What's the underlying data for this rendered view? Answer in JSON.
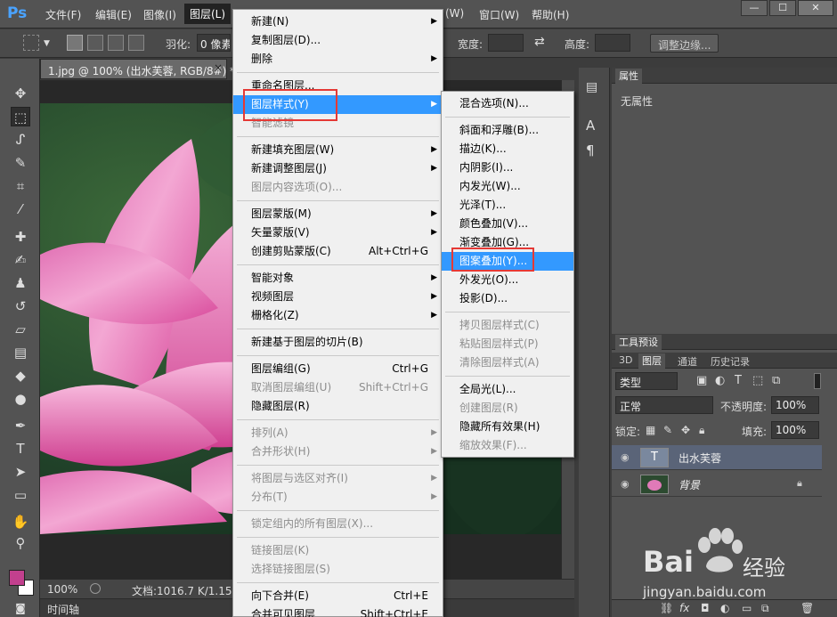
{
  "app": {
    "logo": "Ps"
  },
  "menubar": {
    "items": [
      "文件(F)",
      "编辑(E)",
      "图像(I)",
      "图层(L)",
      "窗口(W)",
      "帮助(H)"
    ],
    "partial_item": "(W)",
    "window_buttons": [
      "—",
      "☐",
      "✕"
    ]
  },
  "options": {
    "feather_label": "羽化:",
    "feather_value": "0 像素",
    "width_label": "宽度:",
    "height_label": "高度:",
    "refine_edge": "调整边缘..."
  },
  "document": {
    "tab_title": "1.jpg @ 100% (出水芙蓉, RGB/8#) *",
    "close": "×",
    "zoom": "100%",
    "doc_info": "文档:1016.7 K/1.15M",
    "timeline": "时间轴"
  },
  "properties_panel": {
    "tab": "属性",
    "content": "无属性"
  },
  "tool_presets": {
    "tab": "工具预设"
  },
  "layers_panel": {
    "tabs": [
      "3D",
      "图层",
      "通道",
      "历史记录"
    ],
    "active_tab": "图层",
    "filter_kind": "类型",
    "blend_mode": "正常",
    "opacity_label": "不透明度:",
    "opacity_value": "100%",
    "lock_label": "锁定:",
    "fill_label": "填充:",
    "fill_value": "100%",
    "layers": [
      {
        "name": "出水芙蓉",
        "type": "text",
        "thumb": "T",
        "selected": true
      },
      {
        "name": "背景",
        "type": "image",
        "locked": true,
        "selected": false
      }
    ]
  },
  "layer_menu": {
    "items": [
      {
        "label": "新建(N)",
        "submenu": true
      },
      {
        "label": "复制图层(D)..."
      },
      {
        "label": "删除",
        "submenu": true
      },
      {
        "sep": true
      },
      {
        "label": "重命名图层..."
      },
      {
        "label": "图层样式(Y)",
        "submenu": true,
        "highlighted": true
      },
      {
        "label": "智能滤镜",
        "disabled": true
      },
      {
        "sep": true
      },
      {
        "label": "新建填充图层(W)",
        "submenu": true
      },
      {
        "label": "新建调整图层(J)",
        "submenu": true
      },
      {
        "label": "图层内容选项(O)...",
        "disabled": true
      },
      {
        "sep": true
      },
      {
        "label": "图层蒙版(M)",
        "submenu": true
      },
      {
        "label": "矢量蒙版(V)",
        "submenu": true
      },
      {
        "label": "创建剪贴蒙版(C)",
        "shortcut": "Alt+Ctrl+G"
      },
      {
        "sep": true
      },
      {
        "label": "智能对象",
        "submenu": true
      },
      {
        "label": "视频图层",
        "submenu": true
      },
      {
        "label": "栅格化(Z)",
        "submenu": true
      },
      {
        "sep": true
      },
      {
        "label": "新建基于图层的切片(B)"
      },
      {
        "sep": true
      },
      {
        "label": "图层编组(G)",
        "shortcut": "Ctrl+G"
      },
      {
        "label": "取消图层编组(U)",
        "shortcut": "Shift+Ctrl+G",
        "disabled": true
      },
      {
        "label": "隐藏图层(R)"
      },
      {
        "sep": true
      },
      {
        "label": "排列(A)",
        "submenu": true,
        "disabled": true
      },
      {
        "label": "合并形状(H)",
        "submenu": true,
        "disabled": true
      },
      {
        "sep": true
      },
      {
        "label": "将图层与选区对齐(I)",
        "submenu": true,
        "disabled": true
      },
      {
        "label": "分布(T)",
        "submenu": true,
        "disabled": true
      },
      {
        "sep": true
      },
      {
        "label": "锁定组内的所有图层(X)...",
        "disabled": true
      },
      {
        "sep": true
      },
      {
        "label": "链接图层(K)",
        "disabled": true
      },
      {
        "label": "选择链接图层(S)",
        "disabled": true
      },
      {
        "sep": true
      },
      {
        "label": "向下合并(E)",
        "shortcut": "Ctrl+E"
      },
      {
        "label": "合并可见图层",
        "shortcut": "Shift+Ctrl+E"
      }
    ]
  },
  "style_submenu": {
    "items": [
      {
        "label": "混合选项(N)..."
      },
      {
        "sep": true
      },
      {
        "label": "斜面和浮雕(B)..."
      },
      {
        "label": "描边(K)..."
      },
      {
        "label": "内阴影(I)..."
      },
      {
        "label": "内发光(W)..."
      },
      {
        "label": "光泽(T)..."
      },
      {
        "label": "颜色叠加(V)..."
      },
      {
        "label": "渐变叠加(G)..."
      },
      {
        "label": "图案叠加(Y)...",
        "highlighted": true
      },
      {
        "label": "外发光(O)..."
      },
      {
        "label": "投影(D)..."
      },
      {
        "sep": true
      },
      {
        "label": "拷贝图层样式(C)",
        "disabled": true
      },
      {
        "label": "粘贴图层样式(P)",
        "disabled": true
      },
      {
        "label": "清除图层样式(A)",
        "disabled": true
      },
      {
        "sep": true
      },
      {
        "label": "全局光(L)..."
      },
      {
        "label": "创建图层(R)",
        "disabled": true
      },
      {
        "label": "隐藏所有效果(H)"
      },
      {
        "label": "缩放效果(F)...",
        "disabled": true
      }
    ]
  },
  "watermark": {
    "brand": "Bai",
    "brand_suffix": "经验",
    "url": "jingyan.baidu.com"
  },
  "colors": {
    "highlight": "#3399ff",
    "annotation": "#e53935",
    "fg_swatch": "#c2408e",
    "bg_swatch": "#ffffff"
  }
}
